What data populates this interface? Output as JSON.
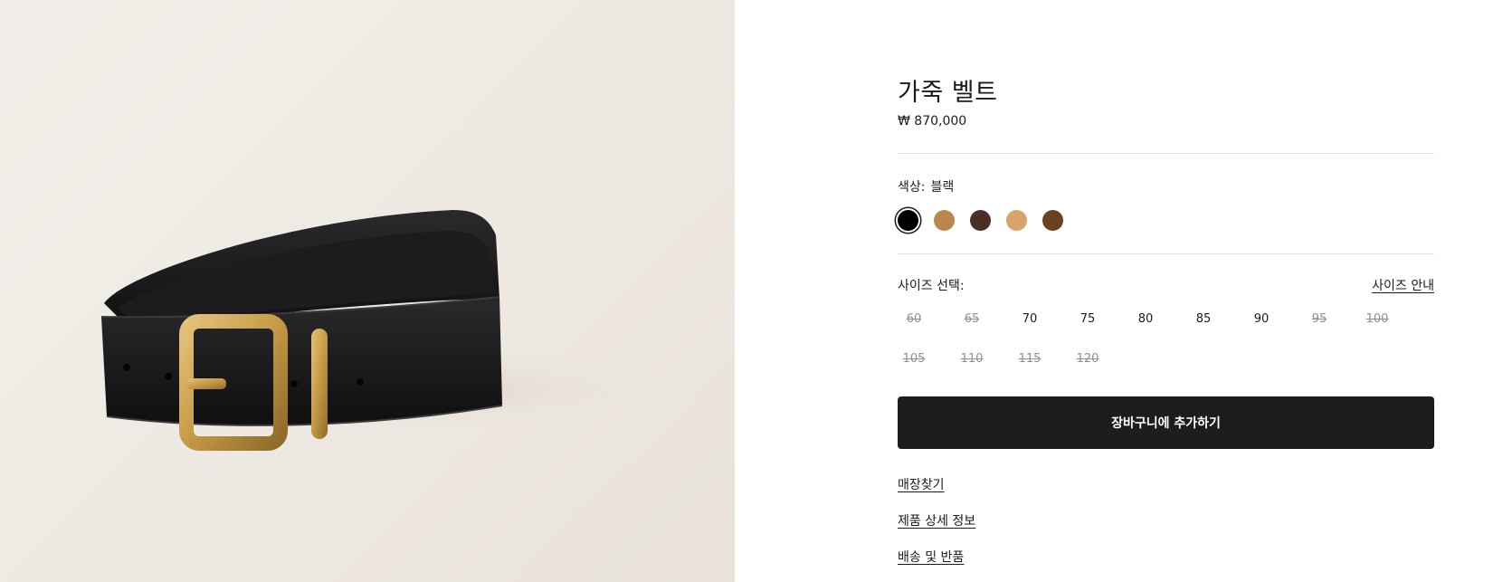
{
  "product": {
    "title": "가죽 벨트",
    "price": "₩ 870,000"
  },
  "color": {
    "label": "색상:",
    "selected": "블랙",
    "swatches": [
      {
        "name": "black",
        "hex": "#000000",
        "selected": true
      },
      {
        "name": "tan",
        "hex": "#b7874f",
        "selected": false
      },
      {
        "name": "dark-brown",
        "hex": "#4a2f24",
        "selected": false
      },
      {
        "name": "light-tan",
        "hex": "#d7a46d",
        "selected": false
      },
      {
        "name": "brown",
        "hex": "#6a4220",
        "selected": false
      }
    ]
  },
  "size": {
    "label": "사이즈 선택:",
    "guide": "사이즈 안내",
    "options": [
      {
        "label": "60",
        "available": false
      },
      {
        "label": "65",
        "available": false
      },
      {
        "label": "70",
        "available": true
      },
      {
        "label": "75",
        "available": true
      },
      {
        "label": "80",
        "available": true
      },
      {
        "label": "85",
        "available": true
      },
      {
        "label": "90",
        "available": true
      },
      {
        "label": "95",
        "available": false
      },
      {
        "label": "100",
        "available": false
      },
      {
        "label": "105",
        "available": false
      },
      {
        "label": "110",
        "available": false
      },
      {
        "label": "115",
        "available": false
      },
      {
        "label": "120",
        "available": false
      }
    ]
  },
  "cart_button": "장바구니에 추가하기",
  "links": {
    "store": "매장찾기",
    "details": "제품 상세 정보",
    "shipping": "배송 및 반품"
  }
}
